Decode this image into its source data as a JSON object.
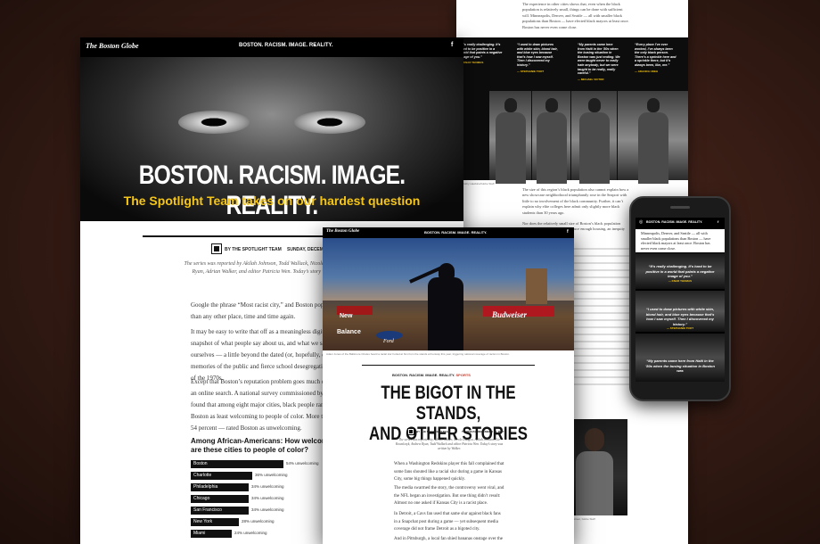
{
  "right_page": {
    "intro": "The experience in other cities shows that, even when the black population is relatively small, things can be done with sufficient will. Minneapolis, Denver, and Seattle — all with smaller black populations than Boston — have elected black mayors at least once. Boston has never even come close.",
    "quotes": [
      {
        "text": "“It’s really challenging. It’s hard to be positive in a world that paints a negative image of you.”",
        "by": "— KNAR THOMAS"
      },
      {
        "text": "“I used to draw pictures with white skin, blond hair, and blue eyes because that’s how I saw myself. Then I discovered my history.”",
        "by": "— STEPHANIE TOOT"
      },
      {
        "text": "“My parents came here from Haiti in the ’80s when the busing situation in Boston was just ending. We were taught never to really hate anybody, but we were taught to be really, really careful.”",
        "by": "— MICHAEL VICTOR"
      },
      {
        "text": "“Every place I’ve ever worked, I’ve always been the only black person. There’s a sprinkle here and a sprinkle there, but it’s always been, like, me.”",
        "by": "— ADAORA UDEH"
      }
    ],
    "caption": "Dorothy Hawkins/Globe Staff",
    "para1": "The size of this region’s black population also cannot explain how a new showcase neighborhood triumphantly rose in the Seaport with little to no involvement of the black community. Further, it can’t explain why elite colleges here admit only slightly more black students than 30 years ago.",
    "para2": "Nor does the relatively small size of Boston’s black population explain how the city fails to produce enough housing, an inequity the Spotlight Team found.",
    "photo_caption": "Charlotte Street, Globe Staff"
  },
  "main_page": {
    "logo": "The Boston Globe",
    "nav_title": "BOSTON. RACISM. IMAGE. REALITY.",
    "hero_title": "BOSTON. RACISM. IMAGE. REALITY.",
    "hero_sub": "The Spotlight Team takes on our hardest question",
    "byline": "BY THE SPOTLIGHT TEAM",
    "date": "SUNDAY, DECEMBER",
    "reporters": "The series was reported by Akilah Johnson, Todd Wallack, Nicole Dungca, Andrew Ryan, Adrian Walker, and editor Patricia Wen. Today’s story was written by",
    "p1": "Google the phrase “Most racist city,” and Boston pops up more than any other place, time and time again.",
    "p2": "It may be easy to write that off as a meaningless digital snapshot of what people say about us, and what we say about ourselves — a little beyond the dated (or, hopefully, outdated) memories of the public and fierce school desegregation battles of the 1970s.",
    "p3": "Except that Boston’s reputation problem goes much deeper than an online search. A national survey commissioned by the Globe found that among eight major cities, black people ranked Boston as least welcoming to people of color. More than half — 54 percent — rated Boston as unwelcoming."
  },
  "chart_data": {
    "type": "bar",
    "title": "Among African-Americans: How welcoming are these cities to people of color?",
    "categories": [
      "Boston",
      "Charlotte",
      "Philadelphia",
      "Chicago",
      "San Francisco",
      "New York",
      "Miami"
    ],
    "values": [
      54,
      36,
      34,
      34,
      34,
      28,
      24
    ],
    "value_suffix": "% unwelcoming",
    "xlim": [
      0,
      54
    ]
  },
  "mid_page": {
    "logo": "The Boston Globe",
    "nav_title": "BOSTON. RACISM. IMAGE. REALITY.",
    "photo_caption": "Adam Jones of the Baltimore Orioles heard a racial slur hurled at him from the stands at Fenway this year, triggering national coverage of racism in Boston.",
    "section": "BOSTON. RACISM. IMAGE. REALITY.",
    "section_tag": "SPORTS",
    "title_line1": "THE BIGOT IN THE STANDS,",
    "title_line2": "AND OTHER STORIES",
    "byline": "BY THE SPOTLIGHT TEAM",
    "date": "THURSDAY, DECEMBER 14, 2017",
    "reporters": "The series was reported by Adrian Walker, Nicole Dungca, Akilah Johnson, Liz Kowalczyk, Andrew Ryan, Todd Wallack and editor Patricia Wen. Today’s story was written by Walker.",
    "p1": "When a Washington Redskins player this fall complained that some fans shouted like a racial slur during a game in Kansas City, some big things happened quickly.",
    "p2": "The media swarmed the story, the controversy went viral, and the NFL began an investigation. But one thing didn’t result: Almost no one asked if Kansas City is a racist place.",
    "p3": "In Detroit, a Cavs fan used that same slur against black fans in a Snapchat post during a game — yet subsequent media coverage did not frame Detroit as a bigoted city.",
    "p4": "And in Pittsburgh, a local fan shied bananas onstage over the Bruins’",
    "sign1": "New Balance",
    "sign2": "Budweiser",
    "sign3": "Ford"
  },
  "phone": {
    "nav_title": "BOSTON. RACISM. IMAGE. REALITY.",
    "intro": "Minneapolis, Denver, and Seattle — all with smaller black populations than Boston — have elected black mayors at least once. Boston has never even come close.",
    "q1": "“It’s really challenging. It’s hard to be positive in a world that paints a negative image of you.”",
    "q1_by": "— KNAR THOMAS",
    "q2": "“I used to draw pictures with white skin, blond hair, and blue eyes because that’s how I saw myself. Then I discovered my history.”",
    "q2_by": "— STEPHANIE TOOT",
    "q3": "“My parents came here from Haiti in the ’80s when the busing situation in Boston was"
  }
}
